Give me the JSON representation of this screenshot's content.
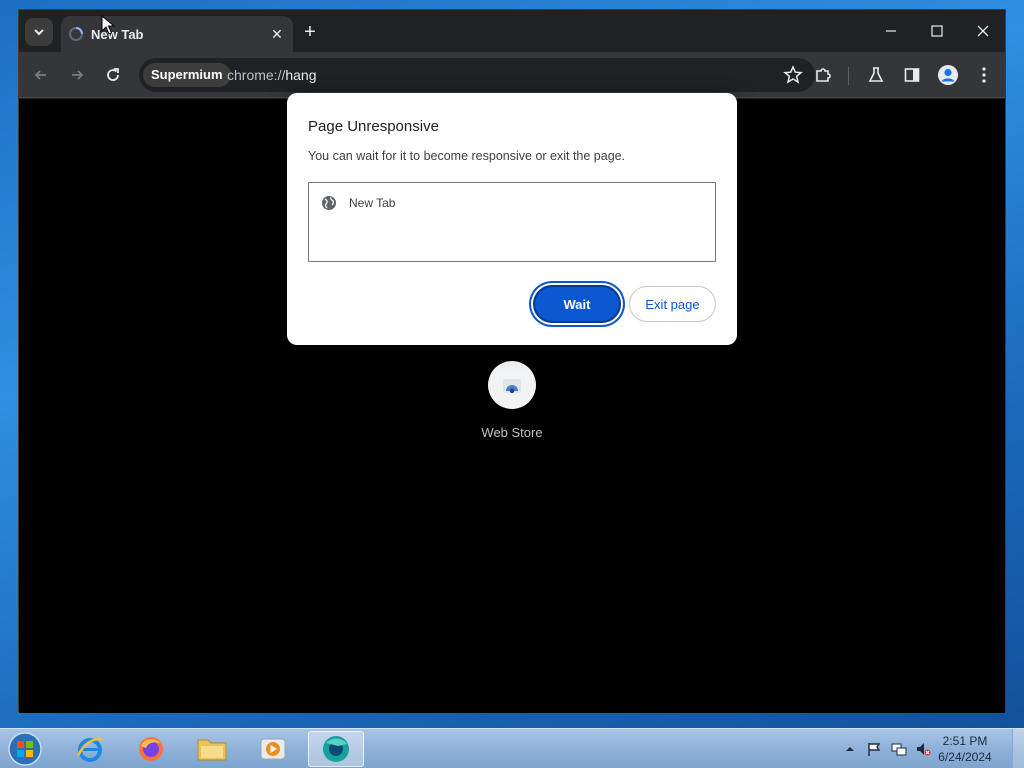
{
  "browser": {
    "tab": {
      "title": "New Tab"
    },
    "omnibox": {
      "chip": "Supermium",
      "scheme": "chrome://",
      "host": "hang"
    }
  },
  "newtab": {
    "shortcut_label": "Web Store"
  },
  "dialog": {
    "title": "Page Unresponsive",
    "message": "You can wait for it to become responsive or exit the page.",
    "pages": [
      {
        "label": "New Tab"
      }
    ],
    "wait_label": "Wait",
    "exit_label": "Exit page"
  },
  "taskbar": {
    "apps": [
      "internet-explorer",
      "firefox",
      "file-explorer",
      "media-player",
      "supermium"
    ],
    "clock_time": "2:51 PM",
    "clock_date": "6/24/2024"
  },
  "colors": {
    "accent": "#0b57d0",
    "taskbar": "#8fb2d9",
    "chrome_dark": "#35363a"
  }
}
